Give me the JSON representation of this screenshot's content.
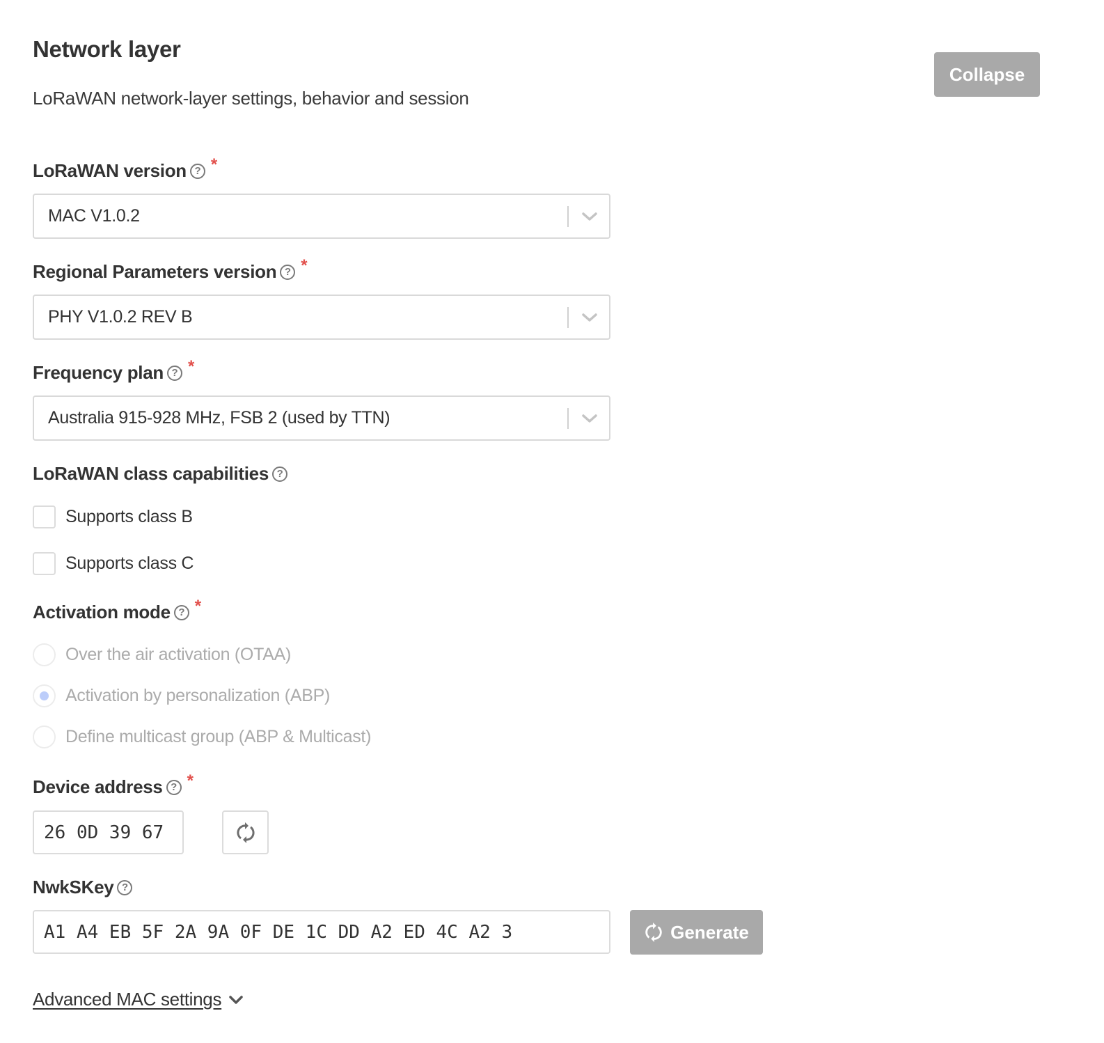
{
  "section": {
    "title": "Network layer",
    "subtitle": "LoRaWAN network-layer settings, behavior and session",
    "collapse_label": "Collapse"
  },
  "fields": {
    "lorawan_version": {
      "label": "LoRaWAN version",
      "required_mark": "*",
      "value": "MAC V1.0.2"
    },
    "regional_parameters_version": {
      "label": "Regional Parameters version",
      "required_mark": "*",
      "value": "PHY V1.0.2 REV B"
    },
    "frequency_plan": {
      "label": "Frequency plan",
      "required_mark": "*",
      "value": "Australia 915-928 MHz, FSB 2 (used by TTN)"
    },
    "class_capabilities": {
      "label": "LoRaWAN class capabilities",
      "options": [
        {
          "label": "Supports class B",
          "checked": false
        },
        {
          "label": "Supports class C",
          "checked": false
        }
      ]
    },
    "activation_mode": {
      "label": "Activation mode",
      "required_mark": "*",
      "options": [
        {
          "label": "Over the air activation (OTAA)",
          "selected": false
        },
        {
          "label": "Activation by personalization (ABP)",
          "selected": true
        },
        {
          "label": "Define multicast group (ABP & Multicast)",
          "selected": false
        }
      ]
    },
    "device_address": {
      "label": "Device address",
      "required_mark": "*",
      "value": "26 0D 39 67"
    },
    "nwkskey": {
      "label": "NwkSKey",
      "value": "A1 A4 EB 5F 2A 9A 0F DE 1C DD A2 ED 4C A2 3",
      "generate_label": "Generate"
    }
  },
  "advanced": {
    "label": "Advanced MAC settings"
  },
  "icons": {
    "help": "?",
    "chevron": "chevron-down-icon",
    "refresh": "refresh-icon"
  },
  "colors": {
    "required": "#e2504c",
    "button_disabled": "#a9a9a9",
    "radio_selected_dot": "#bccdfa"
  }
}
